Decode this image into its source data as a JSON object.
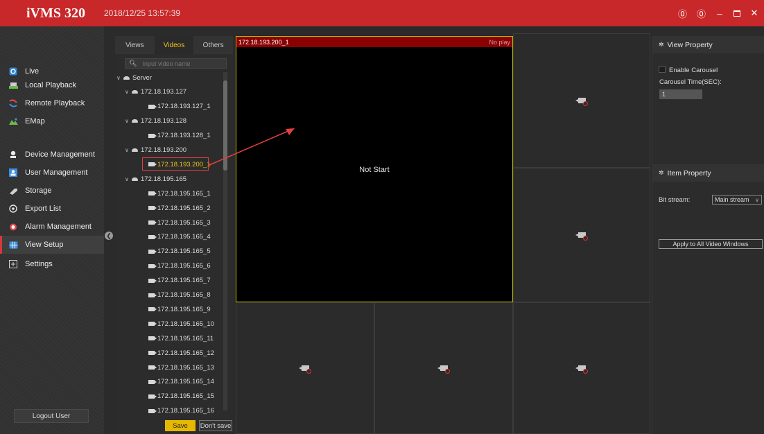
{
  "app": {
    "title": "iVMS 320",
    "datetime": "2018/12/25 13:57:39"
  },
  "window_controls": {
    "info": "⓪",
    "help": "⓪",
    "minimize": "–",
    "close": "✕"
  },
  "sidebar": {
    "items": [
      {
        "label": "Live",
        "icon": "live-icon"
      },
      {
        "label": "Local Playback",
        "icon": "local-playback-icon"
      },
      {
        "label": "Remote Playback",
        "icon": "remote-playback-icon"
      },
      {
        "label": "EMap",
        "icon": "emap-icon"
      },
      {
        "label": "Device Management",
        "icon": "device-management-icon"
      },
      {
        "label": "User Management",
        "icon": "user-management-icon"
      },
      {
        "label": "Storage",
        "icon": "storage-icon"
      },
      {
        "label": "Export List",
        "icon": "export-list-icon"
      },
      {
        "label": "Alarm Management",
        "icon": "alarm-icon"
      },
      {
        "label": "View Setup",
        "icon": "view-setup-icon",
        "active": true
      },
      {
        "label": "Settings",
        "icon": "settings-icon"
      }
    ],
    "logout_label": "Logout User"
  },
  "tree": {
    "tabs": [
      "Views",
      "Videos",
      "Others"
    ],
    "active_tab": "Videos",
    "search_placeholder": "Input video name",
    "nodes": [
      {
        "label": "Server",
        "type": "server",
        "level": 0
      },
      {
        "label": "172.18.193.127",
        "type": "server",
        "level": 1
      },
      {
        "label": "172.18.193.127_1",
        "type": "camera",
        "level": 2
      },
      {
        "label": "172.18.193.128",
        "type": "server",
        "level": 1
      },
      {
        "label": "172.18.193.128_1",
        "type": "camera",
        "level": 2
      },
      {
        "label": "172.18.193.200",
        "type": "server",
        "level": 1
      },
      {
        "label": "172.18.193.200_1",
        "type": "camera",
        "level": 2,
        "selected": true
      },
      {
        "label": "172.18.195.165",
        "type": "server",
        "level": 1
      },
      {
        "label": "172.18.195.165_1",
        "type": "camera",
        "level": 2
      },
      {
        "label": "172.18.195.165_2",
        "type": "camera",
        "level": 2
      },
      {
        "label": "172.18.195.165_3",
        "type": "camera",
        "level": 2
      },
      {
        "label": "172.18.195.165_4",
        "type": "camera",
        "level": 2
      },
      {
        "label": "172.18.195.165_5",
        "type": "camera",
        "level": 2
      },
      {
        "label": "172.18.195.165_6",
        "type": "camera",
        "level": 2
      },
      {
        "label": "172.18.195.165_7",
        "type": "camera",
        "level": 2
      },
      {
        "label": "172.18.195.165_8",
        "type": "camera",
        "level": 2
      },
      {
        "label": "172.18.195.165_9",
        "type": "camera",
        "level": 2
      },
      {
        "label": "172.18.195.165_10",
        "type": "camera",
        "level": 2
      },
      {
        "label": "172.18.195.165_11",
        "type": "camera",
        "level": 2
      },
      {
        "label": "172.18.195.165_12",
        "type": "camera",
        "level": 2
      },
      {
        "label": "172.18.195.165_13",
        "type": "camera",
        "level": 2
      },
      {
        "label": "172.18.195.165_14",
        "type": "camera",
        "level": 2
      },
      {
        "label": "172.18.195.165_15",
        "type": "camera",
        "level": 2
      },
      {
        "label": "172.18.195.165_16",
        "type": "camera",
        "level": 2
      }
    ],
    "save_label": "Save",
    "dont_save_label": "Don't save"
  },
  "video": {
    "main_title": "172.18.193.200_1",
    "main_status": "No play",
    "main_text": "Not Start"
  },
  "view_property": {
    "title": "View Property",
    "enable_carousel": "Enable Carousel",
    "carousel_time_label": "Carousel Time(SEC):",
    "carousel_time_value": "1"
  },
  "item_property": {
    "title": "Item Property",
    "bit_stream_label": "Bit stream:",
    "bit_stream_value": "Main stream",
    "apply_label": "Apply to All Video Windows"
  },
  "colors": {
    "titlebar": "#c8282a",
    "accent": "#f0c419",
    "selection": "#e04040"
  }
}
